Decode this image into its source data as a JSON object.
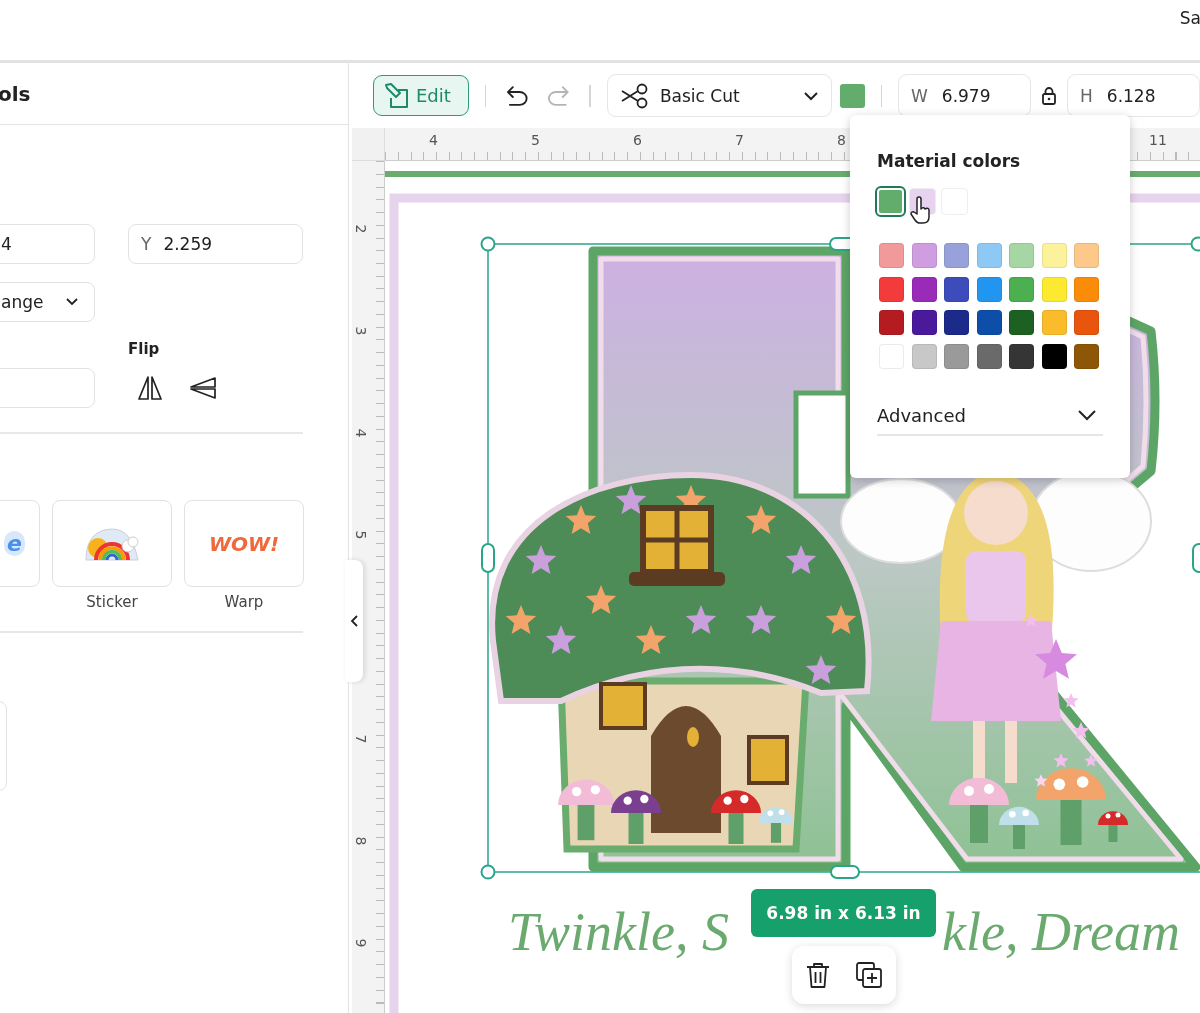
{
  "top_bar": {
    "account_text": "Sa"
  },
  "panel": {
    "title": "ols",
    "x_field": {
      "value": "4"
    },
    "y_field": {
      "label": "Y",
      "value": "2.259"
    },
    "arrange_dropdown": {
      "label": "ange"
    },
    "flip": {
      "label": "Flip"
    },
    "text_styles": [
      {
        "kind": "bubble",
        "art_text": "e"
      },
      {
        "kind": "sticker",
        "label": "Sticker"
      },
      {
        "kind": "warp",
        "art_text": "WOW!",
        "label": "Warp"
      }
    ]
  },
  "toolbar": {
    "edit_button": {
      "label": "Edit"
    },
    "undo": {
      "disabled": false
    },
    "redo": {
      "disabled": true
    },
    "operation": {
      "label": "Basic Cut"
    },
    "color_swatch": {
      "color": "#62ad6b"
    },
    "width_field": {
      "label": "W",
      "value": "6.979"
    },
    "height_field": {
      "label": "H",
      "value": "6.128"
    }
  },
  "rulers": {
    "horizontal": [
      "4",
      "5",
      "6",
      "7",
      "8",
      "11"
    ],
    "vertical": [
      "2",
      "3",
      "4",
      "5",
      "7",
      "8",
      "9"
    ]
  },
  "color_popup": {
    "title": "Material colors",
    "material_swatches": [
      {
        "color": "#62ad6b",
        "selected": true
      },
      {
        "color": "#e7d3ef",
        "selected": false
      },
      {
        "color": "#ffffff",
        "selected": false
      }
    ],
    "palette": [
      {
        "color": "#f09a9c"
      },
      {
        "color": "#cf9de0"
      },
      {
        "color": "#97a2da"
      },
      {
        "color": "#8ec8f5"
      },
      {
        "color": "#a5d6a3"
      },
      {
        "color": "#fcf29c"
      },
      {
        "color": "#fcc98a"
      },
      {
        "color": "#f33b3b"
      },
      {
        "color": "#9a2ab8"
      },
      {
        "color": "#3c4dbb"
      },
      {
        "color": "#2196f0"
      },
      {
        "color": "#4caf50"
      },
      {
        "color": "#fde92f"
      },
      {
        "color": "#fb8c0a"
      },
      {
        "color": "#b51c22"
      },
      {
        "color": "#4b1a9c"
      },
      {
        "color": "#1c2a8a"
      },
      {
        "color": "#0d4fa8"
      },
      {
        "color": "#1c6121"
      },
      {
        "color": "#fbbc2c"
      },
      {
        "color": "#e9550d"
      },
      {
        "color": "#ffffff"
      },
      {
        "color": "#c8c8c8"
      },
      {
        "color": "#9a9a9a"
      },
      {
        "color": "#6a6a6a"
      },
      {
        "color": "#353535"
      },
      {
        "color": "#000000"
      },
      {
        "color": "#8e5707"
      }
    ],
    "advanced": {
      "label": "Advanced",
      "expanded": false
    }
  },
  "canvas": {
    "size_badge": "6.98 in x 6.13 in",
    "design_text": [
      "Twinkle, S",
      "kle, Dream"
    ]
  }
}
